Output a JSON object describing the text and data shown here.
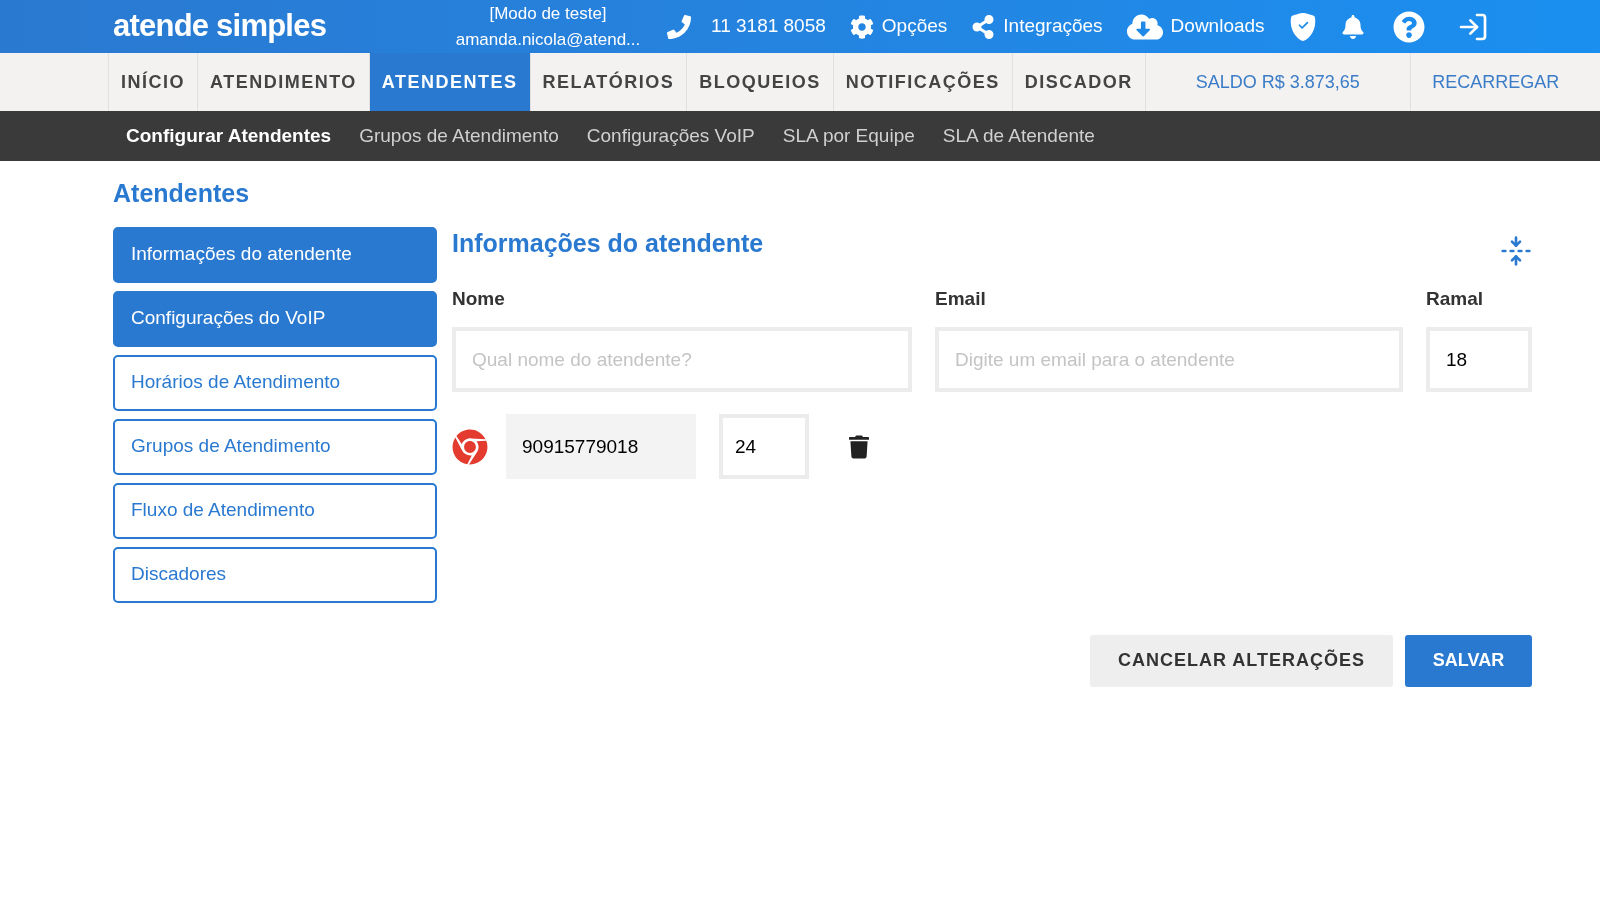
{
  "header": {
    "logo": "atende simples",
    "mode": "[Modo de teste]",
    "user": "amanda.nicola@atend...",
    "phone": "11 3181 8058",
    "links": [
      {
        "kind": "options",
        "label": "Opções"
      },
      {
        "kind": "integrations",
        "label": "Integrações"
      },
      {
        "kind": "downloads",
        "label": "Downloads"
      }
    ]
  },
  "nav": {
    "tabs": [
      {
        "label": "INÍCIO",
        "selected": false
      },
      {
        "label": "ATENDIMENTO",
        "selected": false
      },
      {
        "label": "ATENDENTES",
        "selected": true
      },
      {
        "label": "RELATÓRIOS",
        "selected": false
      },
      {
        "label": "BLOQUEIOS",
        "selected": false
      },
      {
        "label": "NOTIFICAÇÕES",
        "selected": false
      },
      {
        "label": "DISCADOR",
        "selected": false
      }
    ],
    "balance": "SALDO R$ 3.873,65",
    "recharge": "RECARREGAR"
  },
  "subnav": [
    {
      "label": "Configurar Atendentes",
      "selected": true
    },
    {
      "label": "Grupos de Atendimento",
      "selected": false
    },
    {
      "label": "Configurações VoIP",
      "selected": false
    },
    {
      "label": "SLA por Equipe",
      "selected": false
    },
    {
      "label": "SLA de Atendente",
      "selected": false
    }
  ],
  "page_title": "Atendentes",
  "sidebar": [
    {
      "label": "Informações do atendente",
      "selected": true
    },
    {
      "label": "Configurações do VoIP",
      "selected": true
    },
    {
      "label": "Horários de Atendimento",
      "selected": false
    },
    {
      "label": "Grupos de Atendimento",
      "selected": false
    },
    {
      "label": "Fluxo de Atendimento",
      "selected": false
    },
    {
      "label": "Discadores",
      "selected": false
    }
  ],
  "form": {
    "title": "Informações do atendente",
    "name": {
      "label": "Nome",
      "placeholder": "Qual nome do atendente?"
    },
    "email": {
      "label": "Email",
      "placeholder": "Digite um email para o atendente"
    },
    "ramal": {
      "label": "Ramal",
      "value": "18"
    },
    "device": {
      "number": "90915779018",
      "port": "24"
    }
  },
  "buttons": {
    "cancel": "CANCELAR ALTERAÇÕES",
    "save": "SALVAR"
  }
}
